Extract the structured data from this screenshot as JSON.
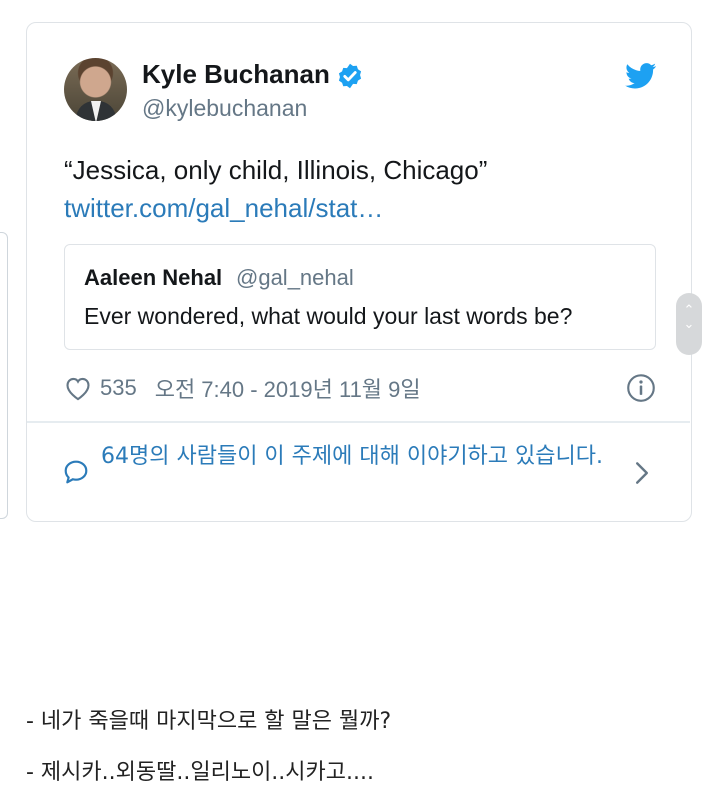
{
  "tweet": {
    "author_name": "Kyle Buchanan",
    "author_handle": "@kylebuchanan",
    "text": "“Jessica, only child, Illinois, Chicago” ",
    "link_text": "twitter.com/gal_nehal/stat…",
    "quoted": {
      "name": "Aaleen Nehal",
      "handle": "@gal_nehal",
      "text": "Ever wondered, what would your last words be?"
    },
    "like_count": "535",
    "timestamp": "오전 7:40 - 2019년 11월 9일",
    "conversation_text": "64명의 사람들이 이 주제에 대해 이야기하고 있습니다."
  },
  "captions": [
    "- 네가 죽을때 마지막으로 할 말은 뭘까?",
    "- 제시카..외동딸..일리노이..시카고...."
  ],
  "icons": {
    "verified": "verified-badge-icon",
    "brand": "twitter-bird-icon",
    "like": "heart-icon",
    "info": "info-icon",
    "conversation": "speech-bubble-icon",
    "expand": "chevron-right-icon"
  },
  "colors": {
    "link": "#2b7bb9",
    "twitter_blue": "#1da1f2",
    "secondary_text": "#657786",
    "border": "#dfe3e7"
  }
}
